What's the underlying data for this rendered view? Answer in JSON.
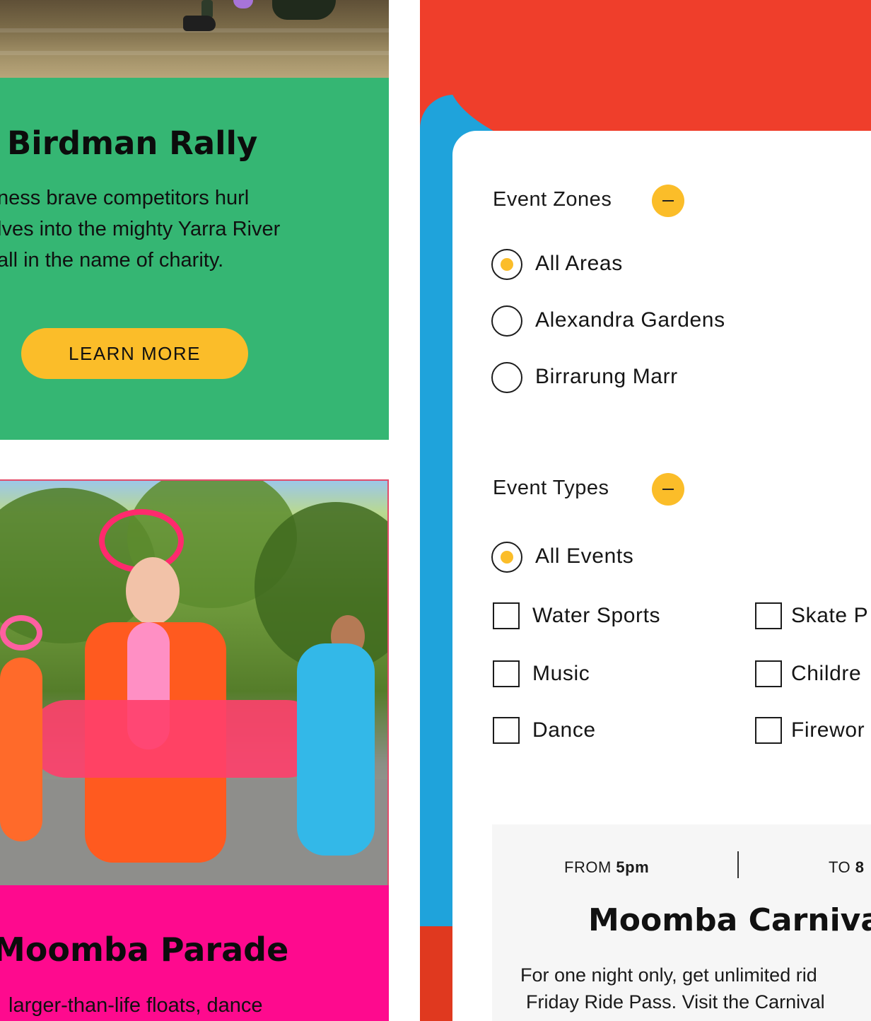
{
  "birdman": {
    "title": "Birdman Rally",
    "body_line1": "ness brave competitors hurl",
    "body_line2": "lves into the mighty Yarra River",
    "body_line3": "all in the name of charity.",
    "cta": "LEARN MORE"
  },
  "parade": {
    "title": "Moomba Parade",
    "body_line1": "larger-than-life floats, dance"
  },
  "filters": {
    "zones": {
      "heading": "Event Zones",
      "options": [
        {
          "label": "All Areas",
          "selected": true
        },
        {
          "label": "Alexandra Gardens",
          "selected": false
        },
        {
          "label": "Birrarung Marr",
          "selected": false
        }
      ]
    },
    "types": {
      "heading": "Event Types",
      "all_label": "All Events",
      "options": [
        {
          "label": "Water Sports",
          "checked": false
        },
        {
          "label": "Skate P",
          "checked": false
        },
        {
          "label": "Music",
          "checked": false
        },
        {
          "label": "Childre",
          "checked": false
        },
        {
          "label": "Dance",
          "checked": false
        },
        {
          "label": "Firewor",
          "checked": false
        }
      ]
    }
  },
  "event": {
    "from_prefix": "FROM",
    "from_time": "5pm",
    "to_prefix": "TO",
    "to_time": "8",
    "title": "Moomba Carniva",
    "desc_line1": "For one night only, get unlimited rid",
    "desc_line2": "Friday Ride Pass. Visit the Carnival"
  },
  "colors": {
    "green": "#35b673",
    "pink": "#fe0a8e",
    "yellow": "#fbbd29",
    "red": "#ef3e2b",
    "blue": "#1fa3db"
  }
}
